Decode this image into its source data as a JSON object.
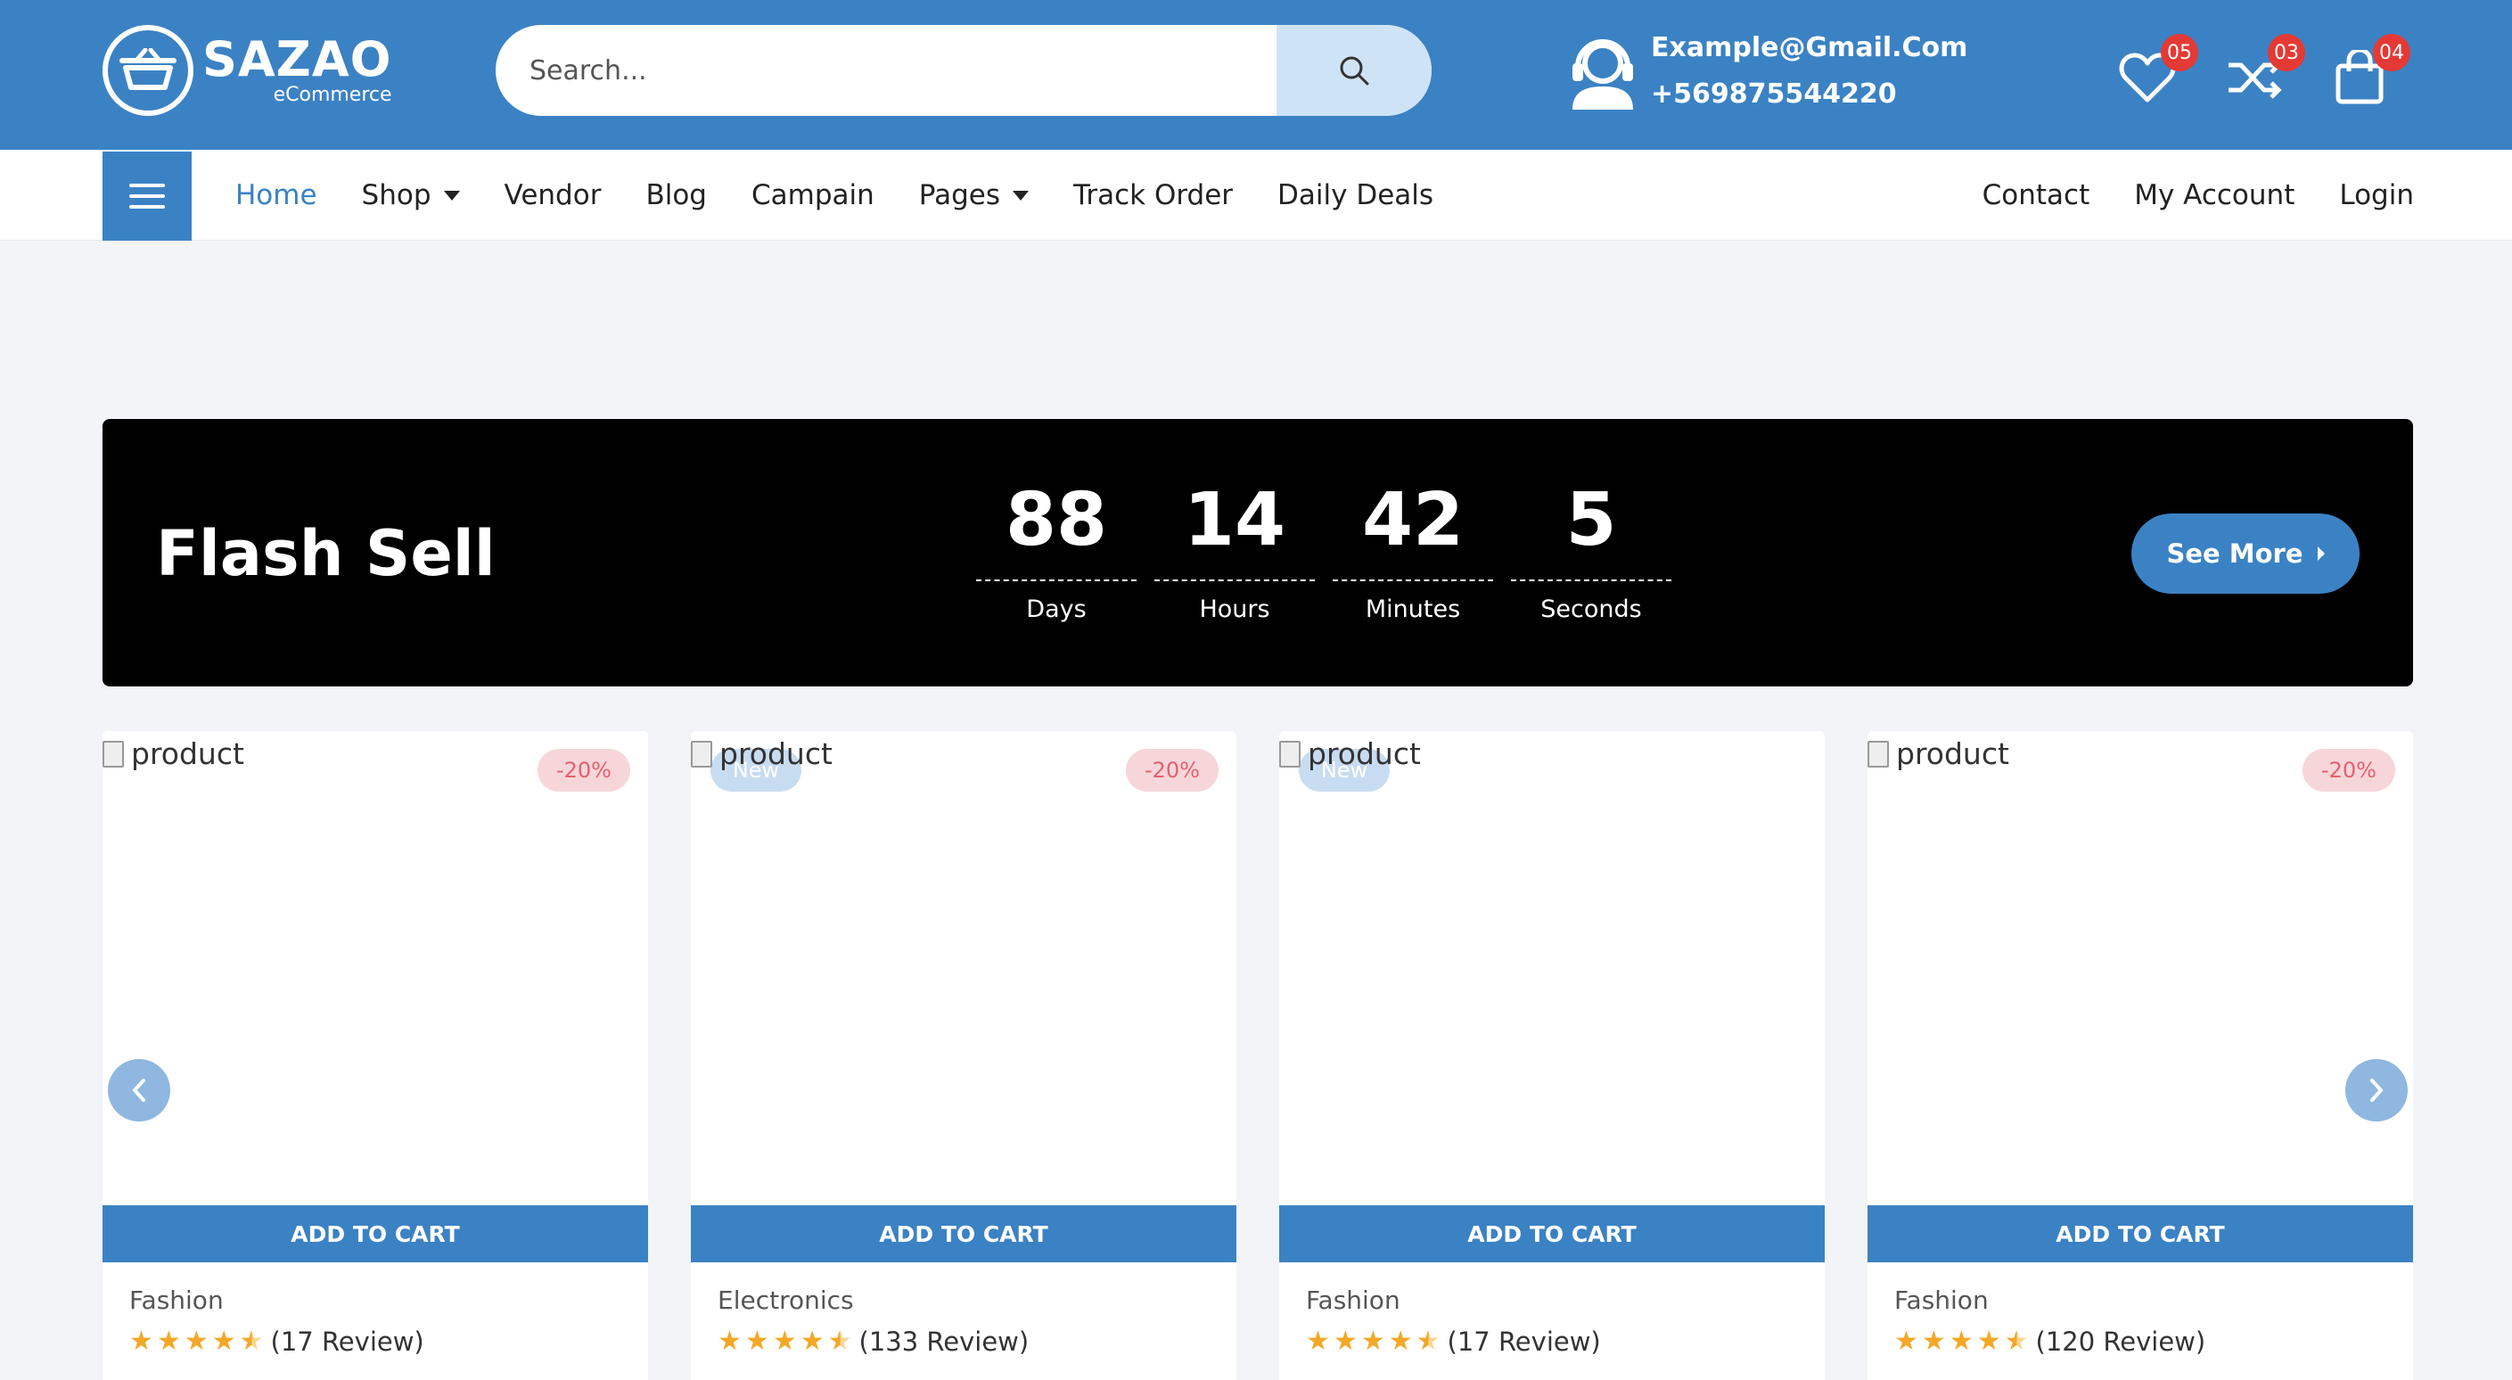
{
  "header": {
    "logo_name": "SAZAO",
    "logo_sub": "eCommerce",
    "search_placeholder": "Search...",
    "contact_email": "Example@Gmail.Com",
    "contact_phone": "+569875544220",
    "wishlist_count": "05",
    "compare_count": "03",
    "cart_count": "04"
  },
  "nav": {
    "items": [
      {
        "label": "Home",
        "active": true
      },
      {
        "label": "Shop",
        "dropdown": true
      },
      {
        "label": "Vendor"
      },
      {
        "label": "Blog"
      },
      {
        "label": "Campain"
      },
      {
        "label": "Pages",
        "dropdown": true
      },
      {
        "label": "Track Order"
      },
      {
        "label": "Daily Deals"
      }
    ],
    "right": [
      "Contact",
      "My Account",
      "Login"
    ]
  },
  "flash": {
    "title": "Flash Sell",
    "countdown": [
      {
        "value": "88",
        "label": "Days"
      },
      {
        "value": "14",
        "label": "Hours"
      },
      {
        "value": "42",
        "label": "Minutes"
      },
      {
        "value": "5",
        "label": "Seconds"
      }
    ],
    "see_more": "See More"
  },
  "products": [
    {
      "img_alt": "product",
      "discount": "-20%",
      "badge": "",
      "add_to_cart": "ADD TO CART",
      "category": "Fashion",
      "rating": 4.5,
      "reviews": "(17 Review)"
    },
    {
      "img_alt": "product",
      "discount": "-20%",
      "badge": "New",
      "add_to_cart": "ADD TO CART",
      "category": "Electronics",
      "rating": 4.5,
      "reviews": "(133 Review)"
    },
    {
      "img_alt": "product",
      "discount": "",
      "badge": "New",
      "add_to_cart": "ADD TO CART",
      "category": "Fashion",
      "rating": 4.5,
      "reviews": "(17 Review)"
    },
    {
      "img_alt": "product",
      "discount": "-20%",
      "badge": "",
      "add_to_cart": "ADD TO CART",
      "category": "Fashion",
      "rating": 4.5,
      "reviews": "(120 Review)"
    }
  ],
  "colors": {
    "primary": "#3b82c4",
    "badge_red": "#e53935",
    "star": "#f3a826",
    "discount_bg": "#f7d6d9",
    "discount_text": "#e46070"
  }
}
